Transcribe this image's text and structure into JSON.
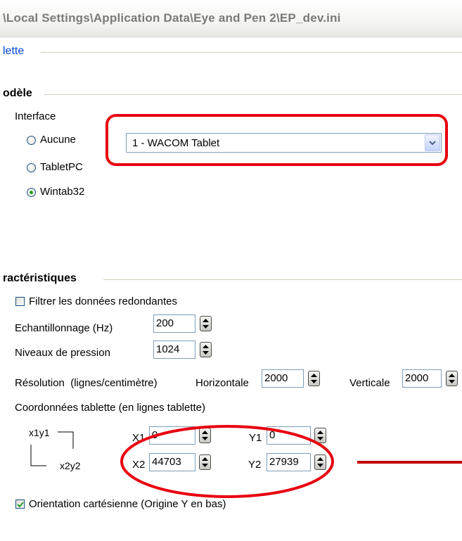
{
  "window": {
    "title": "\\Local Settings\\Application Data\\Eye and Pen 2\\EP_dev.ini"
  },
  "tab": {
    "label": "lette"
  },
  "model_group": {
    "caption": "odèle",
    "interface_label": "Interface",
    "options": [
      {
        "label": "Aucune",
        "selected": false
      },
      {
        "label": "TabletPC",
        "selected": false
      },
      {
        "label": "Wintab32",
        "selected": true
      }
    ],
    "device": {
      "value": "1 - WACOM Tablet"
    }
  },
  "characteristics_group": {
    "caption": "ractéristiques",
    "filter": {
      "label": "Filtrer les données redondantes",
      "checked": false
    },
    "sampling": {
      "label": "Echantillonnage (Hz)",
      "value": "200"
    },
    "pressure": {
      "label": "Niveaux de pression",
      "value": "1024"
    },
    "resolution": {
      "label": "Résolution  (lignes/centimètre)",
      "horizontal_label": "Horizontale",
      "horizontal_value": "2000",
      "vertical_label": "Verticale",
      "vertical_value": "2000"
    },
    "coords": {
      "label": "Coordonnées tablette (en lignes tablette)",
      "diagram_top_left": "x1y1",
      "diagram_bottom_right": "x2y2",
      "x1_label": "X1",
      "x1_value": "0",
      "y1_label": "Y1",
      "y1_value": "0",
      "x2_label": "X2",
      "x2_value": "44703",
      "y2_label": "Y2",
      "y2_value": "27939"
    },
    "orientation": {
      "label": "Orientation cartésienne (Origine Y en bas)",
      "checked": true
    }
  },
  "annotations": {
    "highlight_color": "#e8000f"
  }
}
